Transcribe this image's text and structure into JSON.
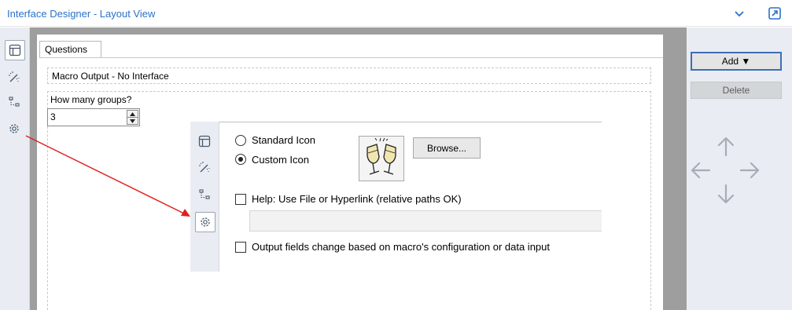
{
  "window": {
    "title": "Interface Designer - Layout View"
  },
  "left_toolbar": {
    "items": [
      {
        "icon": "layout-icon",
        "selected": true
      },
      {
        "icon": "magic-wand-icon",
        "selected": false
      },
      {
        "icon": "tree-icon",
        "selected": false
      },
      {
        "icon": "gear-icon",
        "selected": false
      }
    ]
  },
  "tabs": [
    {
      "label": "Questions",
      "active": true
    }
  ],
  "questions": {
    "macro_output": "Macro Output - No Interface",
    "group_label": "How many groups?",
    "group_value": "3"
  },
  "right_panel": {
    "add_label": "Add ▼",
    "delete_label": "Delete"
  },
  "inset": {
    "standard_icon_label": "Standard Icon",
    "custom_icon_label": "Custom Icon",
    "selected_icon_option": "custom",
    "browse_label": "Browse...",
    "help_label": "Help: Use File or Hyperlink (relative paths OK)",
    "help_value": "",
    "help_checked": false,
    "output_fields_label": "Output fields change based on macro's configuration or data input",
    "output_fields_checked": false
  },
  "colors": {
    "title_text": "#2a72c8",
    "accent_border": "#3c6fb6",
    "annotation_arrow": "#e02020",
    "frame_gray": "#9e9e9e",
    "panel_bg": "#e9edf3"
  }
}
